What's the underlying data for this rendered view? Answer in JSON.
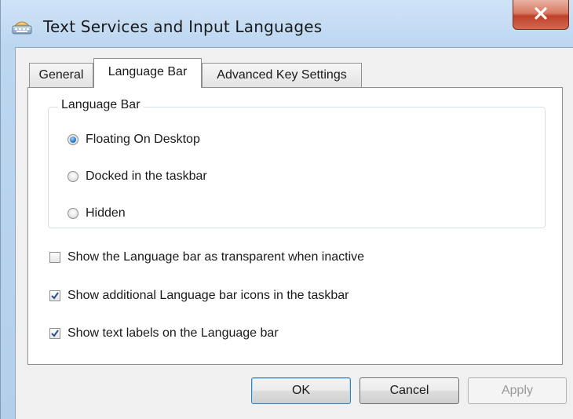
{
  "window": {
    "title": "Text Services and Input Languages",
    "icon": "keyboard-icon"
  },
  "tabs": [
    {
      "label": "General",
      "active": false
    },
    {
      "label": "Language Bar",
      "active": true
    },
    {
      "label": "Advanced Key Settings",
      "active": false
    }
  ],
  "language_bar_group": {
    "label": "Language Bar",
    "options": [
      {
        "label": "Floating On Desktop",
        "checked": true
      },
      {
        "label": "Docked in the taskbar",
        "checked": false
      },
      {
        "label": "Hidden",
        "checked": false
      }
    ]
  },
  "checkboxes": [
    {
      "label": "Show the Language bar as transparent when inactive",
      "checked": false
    },
    {
      "label": "Show additional Language bar icons in the taskbar",
      "checked": true
    },
    {
      "label": "Show text labels on the Language bar",
      "checked": true
    }
  ],
  "buttons": {
    "ok": "OK",
    "cancel": "Cancel",
    "apply": "Apply"
  },
  "colors": {
    "accent": "#2a7fd0",
    "close": "#c0402a"
  }
}
